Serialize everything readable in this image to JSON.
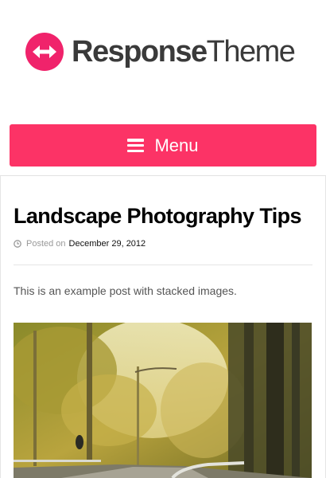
{
  "header": {
    "logo_word_bold": "Response",
    "logo_word_light": "Theme",
    "logo_icon": "double-arrow-icon",
    "brand_color": "#f0236b"
  },
  "nav": {
    "menu_label": "Menu",
    "menu_icon": "hamburger-icon",
    "menu_color": "#fc3366"
  },
  "post": {
    "title": "Landscape Photography Tips",
    "meta_icon": "clock-icon",
    "meta_prefix": "Posted on",
    "date": "December 29, 2012",
    "excerpt": "This is an example post with stacked images.",
    "image_subject": "autumn-forest-road-photo"
  }
}
